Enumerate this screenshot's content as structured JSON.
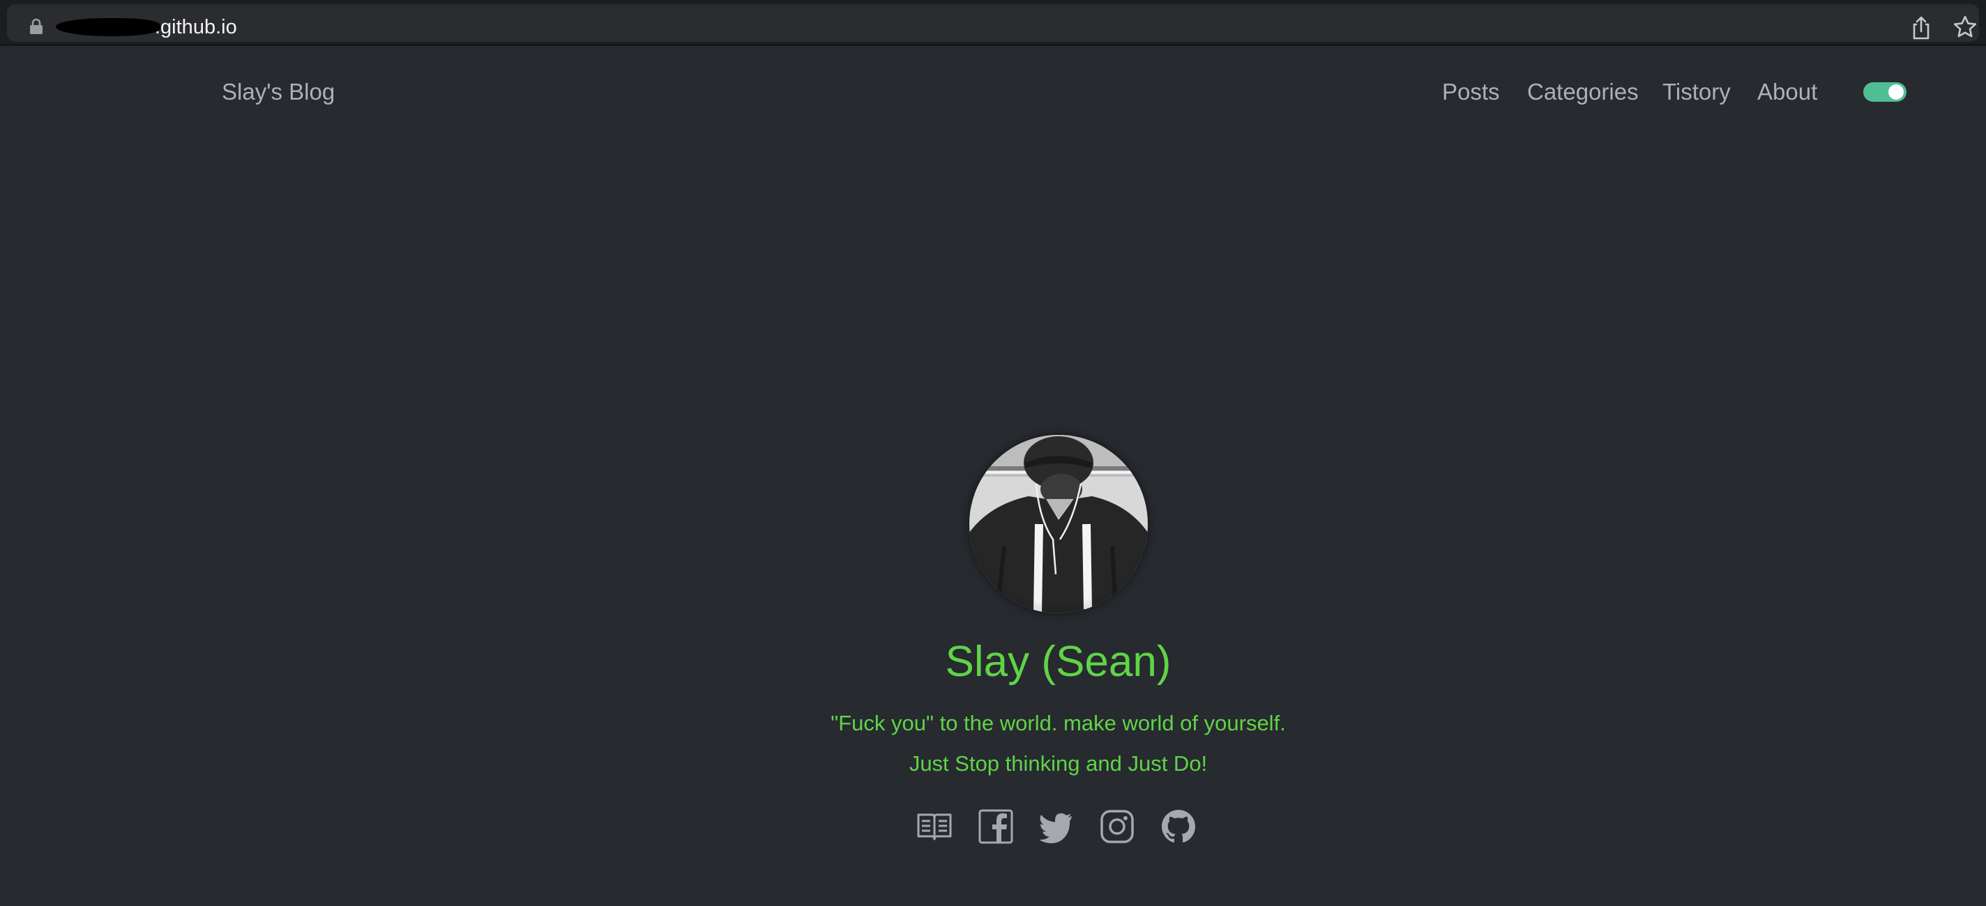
{
  "browser": {
    "url": ".github.io",
    "icons": [
      "lock-icon",
      "share-icon",
      "bookmark-icon"
    ]
  },
  "header": {
    "site_title": "Slay's Blog",
    "nav": [
      {
        "label": "Posts"
      },
      {
        "label": "Categories"
      },
      {
        "label": "Tistory"
      },
      {
        "label": "About"
      }
    ],
    "theme_toggle": {
      "state": "on",
      "color": "#4fbf93"
    }
  },
  "profile": {
    "name": "Slay (Sean)",
    "bio": [
      "\"Fuck you\" to the world. make world of yourself.",
      "Just Stop thinking and Just Do!"
    ],
    "accent_color": "#5fd447",
    "social_icons": [
      "book-icon",
      "facebook-icon",
      "twitter-icon",
      "instagram-icon",
      "github-icon"
    ]
  },
  "colors": {
    "background": "#272a2f",
    "nav_text": "#aeb0b5",
    "icon": "#a6a8ad"
  }
}
